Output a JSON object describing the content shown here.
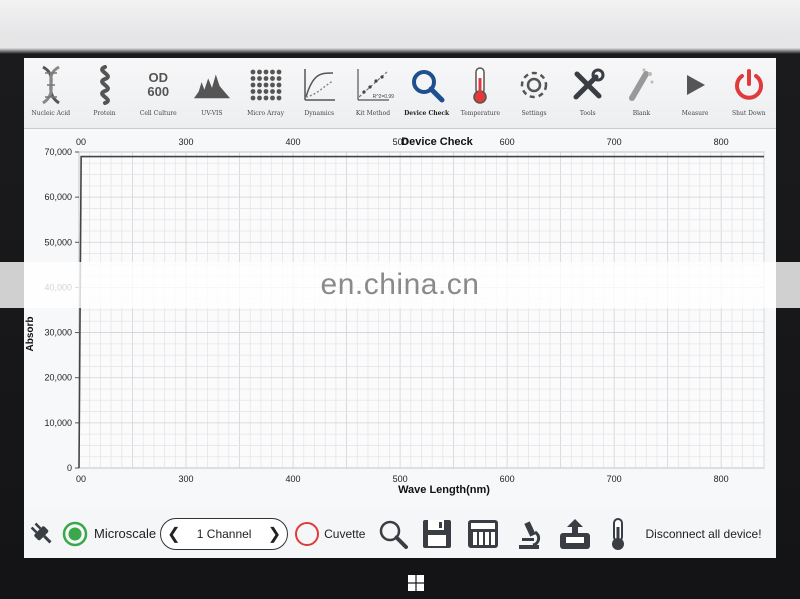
{
  "toolbar": {
    "items": [
      {
        "label": "Nucleic Acid",
        "icon": "dna-icon"
      },
      {
        "label": "Protein",
        "icon": "protein-icon"
      },
      {
        "label": "Cell Culture",
        "icon": "od600-icon",
        "icon_text_top": "OD",
        "icon_text_bottom": "600"
      },
      {
        "label": "UV-VIS",
        "icon": "spectrum-icon"
      },
      {
        "label": "Micro Array",
        "icon": "micro-array-icon"
      },
      {
        "label": "Dynamics",
        "icon": "dynamics-icon"
      },
      {
        "label": "Kit Method",
        "icon": "kit-method-icon",
        "icon_text": "R^2=0.99"
      },
      {
        "label": "Device Check",
        "icon": "magnifier-icon"
      },
      {
        "label": "Temperature",
        "icon": "thermometer-icon"
      },
      {
        "label": "Settings",
        "icon": "gear-icon"
      },
      {
        "label": "Tools",
        "icon": "tools-icon"
      },
      {
        "label": "Blank",
        "icon": "blank-icon"
      },
      {
        "label": "Measure",
        "icon": "play-icon"
      },
      {
        "label": "Shut Down",
        "icon": "power-icon"
      }
    ]
  },
  "chart_data": {
    "type": "line",
    "title": "Device Check",
    "xlabel": "Wave Length(nm)",
    "ylabel": "Absorb",
    "xlim": [
      200,
      840
    ],
    "ylim": [
      0,
      70000
    ],
    "x_ticks_bottom": [
      "300",
      "400",
      "500",
      "600",
      "700",
      "800"
    ],
    "x_ticks_top": [
      "300",
      "400",
      "500",
      "600",
      "700",
      "800"
    ],
    "x_tick_first_top": "00",
    "x_tick_first_bottom": "00",
    "y_ticks": [
      "0",
      "10,000",
      "20,000",
      "30,000",
      "40,000",
      "50,000",
      "60,000",
      "70,000"
    ],
    "grid": true,
    "series": [
      {
        "x": [
          200,
          202,
          840
        ],
        "y": [
          0,
          69000,
          69000
        ]
      }
    ]
  },
  "bottombar": {
    "microscale_label": "Microscale",
    "channel_label": "1 Channel",
    "cuvette_label": "Cuvette",
    "disconnect_label": "Disconnect all device!"
  },
  "watermark": "en.china.cn",
  "colors": {
    "accent_red": "#e03a3a",
    "accent_green": "#3aa84a",
    "icon_dark": "#3a3d44",
    "magnifier_blue": "#1f4f8f"
  }
}
